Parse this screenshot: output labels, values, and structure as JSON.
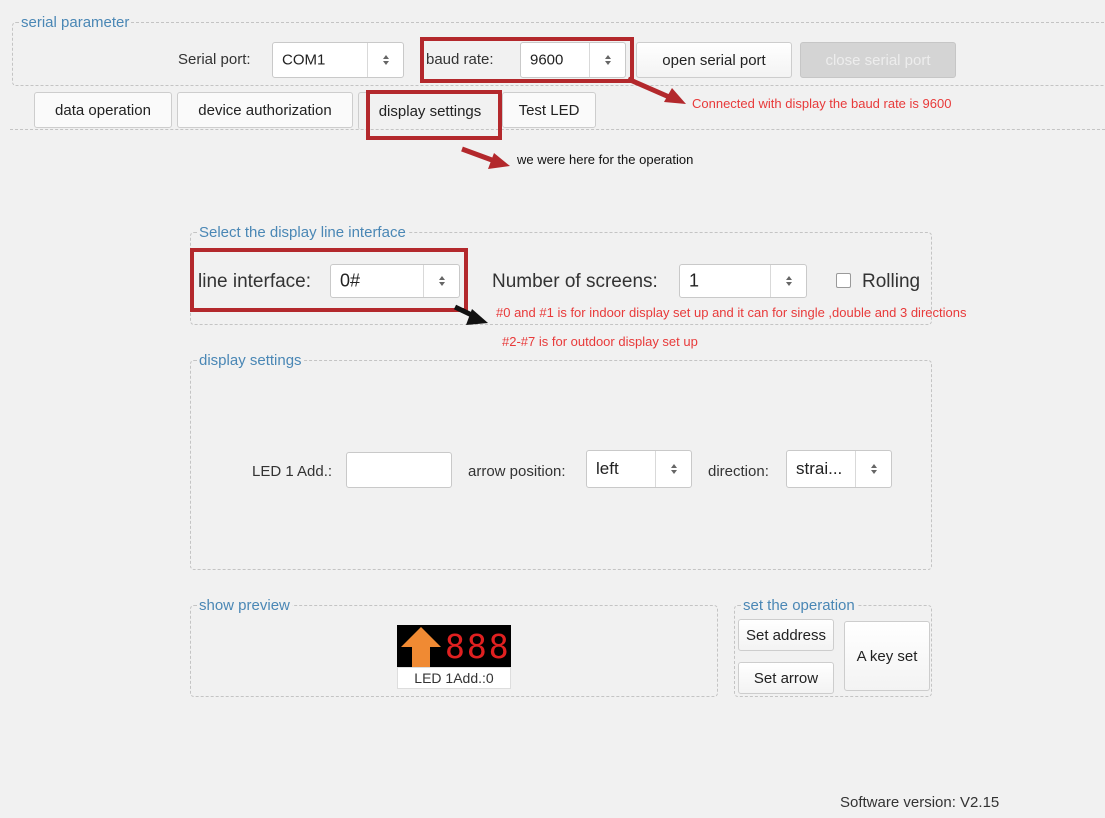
{
  "serial_group": {
    "title": "serial parameter",
    "serial_port_label": "Serial port:",
    "serial_port_value": "COM1",
    "baud_rate_label": "baud rate:",
    "baud_rate_value": "9600",
    "open_button": "open serial port",
    "close_button": "close serial port"
  },
  "tabs": [
    {
      "label": "data operation",
      "active": false
    },
    {
      "label": "device authorization",
      "active": false
    },
    {
      "label": "display settings",
      "active": true
    },
    {
      "label": "Test LED",
      "active": false
    }
  ],
  "annotations": {
    "baud_note": "Connected with display the baud rate is 9600",
    "operation_note": "we were here for the operation",
    "indoor_note": "#0 and #1 is for indoor display set up and it can for single ,double and 3 directions",
    "outdoor_note": "#2-#7 is for outdoor display set up"
  },
  "line_group": {
    "title": "Select the display line interface",
    "line_interface_label": "line interface:",
    "line_interface_value": "0#",
    "screens_label": "Number of screens:",
    "screens_value": "1",
    "rolling_label": "Rolling",
    "rolling_checked": false
  },
  "display_group": {
    "title": "display settings",
    "led_add_label": "LED 1 Add.:",
    "led_add_value": "",
    "arrow_position_label": "arrow position:",
    "arrow_position_value": "left",
    "direction_label": "direction:",
    "direction_value": "strai..."
  },
  "preview_group": {
    "title": "show preview",
    "led_digits": "888",
    "led_caption": "LED 1Add.:0"
  },
  "operation_group": {
    "title": "set the operation",
    "set_address": "Set address",
    "set_arrow": "Set arrow",
    "a_key_set": "A key set"
  },
  "footer": {
    "version": "Software version: V2.15"
  },
  "colors": {
    "background": "#f1f1f1",
    "group_title": "#4a87b5",
    "annotation_red": "#e83a3a",
    "highlight_box": "#b3282c",
    "led_digit": "#e02020",
    "arrow_orange": "#f08a33"
  }
}
